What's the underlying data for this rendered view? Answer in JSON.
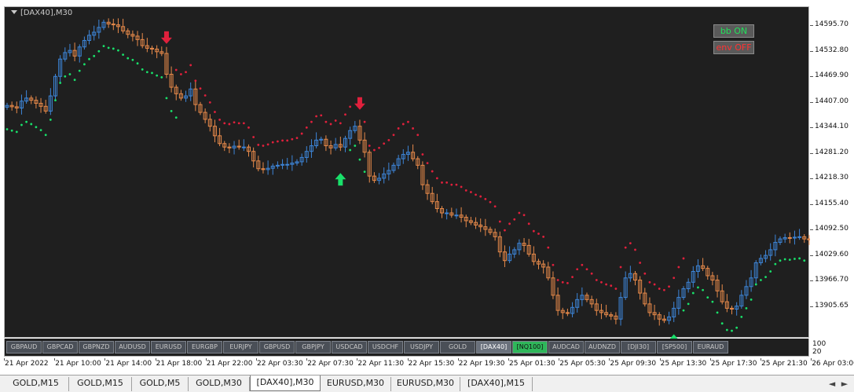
{
  "window": {
    "chart_title": "[DAX40],M30"
  },
  "buttons": {
    "bb": {
      "label": "bb ON",
      "color": "#22e05a"
    },
    "env": {
      "label": "env OFF",
      "color": "#ff3232"
    }
  },
  "symbols": [
    {
      "label": "GBPAUD",
      "state": "normal"
    },
    {
      "label": "GBPCAD",
      "state": "normal"
    },
    {
      "label": "GBPNZD",
      "state": "normal"
    },
    {
      "label": "AUDUSD",
      "state": "normal"
    },
    {
      "label": "EURUSD",
      "state": "normal"
    },
    {
      "label": "EURGBP",
      "state": "normal"
    },
    {
      "label": "EURJPY",
      "state": "normal"
    },
    {
      "label": "GBPUSD",
      "state": "normal"
    },
    {
      "label": "GBPJPY",
      "state": "normal"
    },
    {
      "label": "USDCAD",
      "state": "normal"
    },
    {
      "label": "USDCHF",
      "state": "normal"
    },
    {
      "label": "USDJPY",
      "state": "normal"
    },
    {
      "label": "GOLD",
      "state": "normal"
    },
    {
      "label": "[DAX40]",
      "state": "active-dax"
    },
    {
      "label": "[NQ100]",
      "state": "active-nq"
    },
    {
      "label": "AUDCAD",
      "state": "normal"
    },
    {
      "label": "AUDNZD",
      "state": "normal"
    },
    {
      "label": "[DJI30]",
      "state": "normal"
    },
    {
      "label": "[SP500]",
      "state": "normal"
    },
    {
      "label": "EURAUD",
      "state": "normal"
    }
  ],
  "volume_scale": [
    "100",
    "20"
  ],
  "price_axis": [
    "14595.70",
    "14532.80",
    "14469.90",
    "14407.00",
    "14344.10",
    "14281.20",
    "14218.30",
    "14155.40",
    "14092.50",
    "14029.60",
    "13966.70",
    "13905.65"
  ],
  "time_axis": [
    "21 Apr 2022",
    "21 Apr 10:00",
    "21 Apr 14:00",
    "21 Apr 18:00",
    "21 Apr 22:00",
    "22 Apr 03:30",
    "22 Apr 07:30",
    "22 Apr 11:30",
    "22 Apr 15:30",
    "22 Apr 19:30",
    "25 Apr 01:30",
    "25 Apr 05:30",
    "25 Apr 09:30",
    "25 Apr 13:30",
    "25 Apr 17:30",
    "25 Apr 21:30",
    "26 Apr 03:00"
  ],
  "tabs": [
    {
      "label": "GOLD,M15",
      "active": false
    },
    {
      "label": "GOLD,M15",
      "active": false
    },
    {
      "label": "GOLD,M5",
      "active": false
    },
    {
      "label": "GOLD,M30",
      "active": false
    },
    {
      "label": "[DAX40],M30",
      "active": true
    },
    {
      "label": "EURUSD,M30",
      "active": false
    },
    {
      "label": "EURUSD,M30",
      "active": false
    },
    {
      "label": "[DAX40],M15",
      "active": false
    }
  ],
  "tab_scroll": {
    "left": "◄",
    "right": "►"
  },
  "colors": {
    "bull": "#3d85d8",
    "bear": "#e88a4a",
    "trail_up": "#19e06a",
    "trail_down": "#e0203c",
    "arrow_up": "#19e06a",
    "arrow_down": "#e0203c",
    "plot_bg": "#1f1f1f"
  },
  "chart_data": {
    "type": "candlestick",
    "ylim": [
      13860,
      14625
    ],
    "closes": [
      14398,
      14395,
      14392,
      14408,
      14415,
      14410,
      14403,
      14396,
      14385,
      14420,
      14465,
      14505,
      14520,
      14525,
      14512,
      14533,
      14548,
      14560,
      14567,
      14578,
      14590,
      14586,
      14584,
      14580,
      14570,
      14562,
      14558,
      14550,
      14536,
      14530,
      14528,
      14522,
      14518,
      14470,
      14440,
      14425,
      14415,
      14420,
      14436,
      14400,
      14382,
      14366,
      14350,
      14328,
      14310,
      14302,
      14300,
      14304,
      14302,
      14302,
      14292,
      14270,
      14252,
      14250,
      14253,
      14258,
      14260,
      14262,
      14262,
      14265,
      14268,
      14278,
      14292,
      14305,
      14318,
      14320,
      14305,
      14300,
      14308,
      14302,
      14322,
      14340,
      14350,
      14318,
      14290,
      14235,
      14225,
      14230,
      14240,
      14248,
      14260,
      14275,
      14285,
      14290,
      14275,
      14260,
      14215,
      14195,
      14176,
      14160,
      14150,
      14150,
      14145,
      14145,
      14140,
      14132,
      14128,
      14122,
      14118,
      14112,
      14105,
      14095,
      14060,
      14040,
      14055,
      14065,
      14080,
      14075,
      14055,
      14038,
      14032,
      14025,
      14000,
      13960,
      13925,
      13920,
      13918,
      13932,
      13950,
      13960,
      13950,
      13940,
      13925,
      13920,
      13915,
      13912,
      13905,
      13955,
      14000,
      14010,
      13995,
      13965,
      13940,
      13920,
      13915,
      13905,
      13902,
      13910,
      13930,
      13955,
      13975,
      13990,
      14015,
      14028,
      14022,
      14005,
      13995,
      13970,
      13945,
      13930,
      13928,
      13935,
      13960,
      13980,
      14000,
      14035,
      14045,
      14052,
      14065,
      14082,
      14090,
      14093,
      14092,
      14094,
      14095,
      14090,
      14088
    ],
    "trail_up_1": {
      "start": 0,
      "end": 35
    },
    "trail_down_1": {
      "start": 35,
      "end": 71
    },
    "trail_up_2": {
      "start": 71,
      "end": 74
    },
    "trail_down_2": {
      "start": 74,
      "end": 140
    },
    "trail_up_3": {
      "start": 140,
      "end": 165
    },
    "signal_down": [
      33,
      73
    ],
    "signal_up": [
      69,
      138
    ]
  }
}
